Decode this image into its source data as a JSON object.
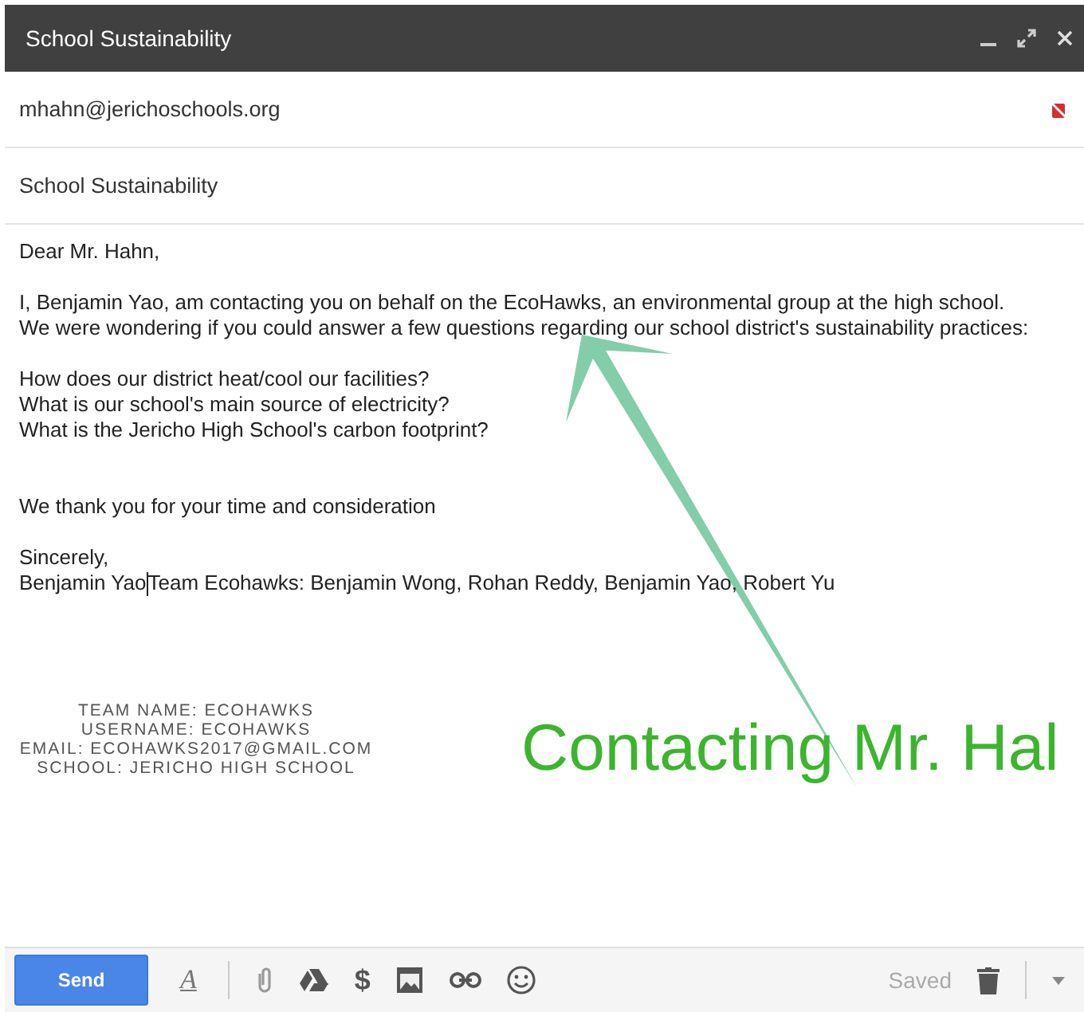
{
  "window": {
    "title": "School Sustainability"
  },
  "to": {
    "value": "mhahn@jerichoschools.org"
  },
  "subject": {
    "value": "School Sustainability"
  },
  "body": {
    "greeting": "Dear Mr. Hahn,",
    "intro": "I, Benjamin Yao, am contacting you on behalf on the EcoHawks, an environmental group at the high school. We were wondering if you could answer a few questions regarding our school district's sustainability practices:",
    "questions": [
      "How does our district heat/cool our facilities?",
      "What is our school's main source of electricity?",
      "What is the Jericho High School's carbon footprint?"
    ],
    "thanks": "We thank you for your time and consideration",
    "closing": "Sincerely,",
    "signature_name": "Benjamin Yao",
    "signature_team": "Team Ecohawks: Benjamin Wong, Rohan Reddy, Benjamin Yao, Robert Yu"
  },
  "team_info": [
    "TEAM NAME: ECOHAWKS",
    "USERNAME: ECOHAWKS",
    "EMAIL: ECOHAWKS2017@GMAIL.COM",
    "SCHOOL: JERICHO HIGH SCHOOL"
  ],
  "annotation": {
    "caption": "Contacting Mr. Hal"
  },
  "toolbar": {
    "send": "Send",
    "format": "A",
    "money": "$",
    "status": "Saved"
  }
}
